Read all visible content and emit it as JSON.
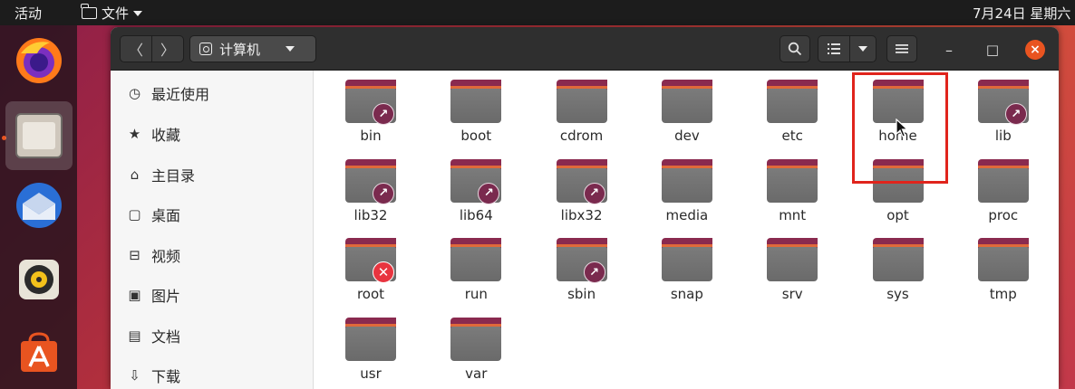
{
  "topbar": {
    "activities": "活动",
    "app_menu": "文件",
    "clock": "7月24日 星期六"
  },
  "dock": {
    "items": [
      {
        "name": "firefox",
        "icon": "firefox-icon"
      },
      {
        "name": "files",
        "icon": "files-icon",
        "active": true
      },
      {
        "name": "thunderbird",
        "icon": "thunderbird-icon"
      },
      {
        "name": "rhythmbox",
        "icon": "rhythmbox-icon"
      },
      {
        "name": "software",
        "icon": "software-store-icon"
      }
    ]
  },
  "headerbar": {
    "back": "〈",
    "forward": "〉",
    "location": "计算机",
    "search_icon": "search-icon",
    "view_icon": "list-view-icon",
    "menu_icon": "hamburger-menu-icon",
    "minimize": "–",
    "maximize": "□",
    "close": "×"
  },
  "sidebar": {
    "items": [
      {
        "label": "最近使用",
        "icon": "◷"
      },
      {
        "label": "收藏",
        "icon": "★"
      },
      {
        "label": "主目录",
        "icon": "⌂"
      },
      {
        "label": "桌面",
        "icon": "▢"
      },
      {
        "label": "视频",
        "icon": "⊟"
      },
      {
        "label": "图片",
        "icon": "▣"
      },
      {
        "label": "文档",
        "icon": "▤"
      },
      {
        "label": "下载",
        "icon": "⇩"
      }
    ]
  },
  "files": [
    {
      "name": "bin",
      "emblem": "link"
    },
    {
      "name": "boot",
      "emblem": ""
    },
    {
      "name": "cdrom",
      "emblem": ""
    },
    {
      "name": "dev",
      "emblem": ""
    },
    {
      "name": "etc",
      "emblem": ""
    },
    {
      "name": "home",
      "emblem": ""
    },
    {
      "name": "lib",
      "emblem": "link"
    },
    {
      "name": "lib32",
      "emblem": "link"
    },
    {
      "name": "lib64",
      "emblem": "link"
    },
    {
      "name": "libx32",
      "emblem": "link"
    },
    {
      "name": "media",
      "emblem": ""
    },
    {
      "name": "mnt",
      "emblem": ""
    },
    {
      "name": "opt",
      "emblem": ""
    },
    {
      "name": "proc",
      "emblem": ""
    },
    {
      "name": "root",
      "emblem": "noaccess"
    },
    {
      "name": "run",
      "emblem": ""
    },
    {
      "name": "sbin",
      "emblem": "link"
    },
    {
      "name": "snap",
      "emblem": ""
    },
    {
      "name": "srv",
      "emblem": ""
    },
    {
      "name": "sys",
      "emblem": ""
    },
    {
      "name": "tmp",
      "emblem": ""
    },
    {
      "name": "usr",
      "emblem": ""
    },
    {
      "name": "var",
      "emblem": ""
    }
  ],
  "colors": {
    "accent": "#e95420",
    "highlight": "#e0241c",
    "folder_tab": "#8a2a4f"
  }
}
